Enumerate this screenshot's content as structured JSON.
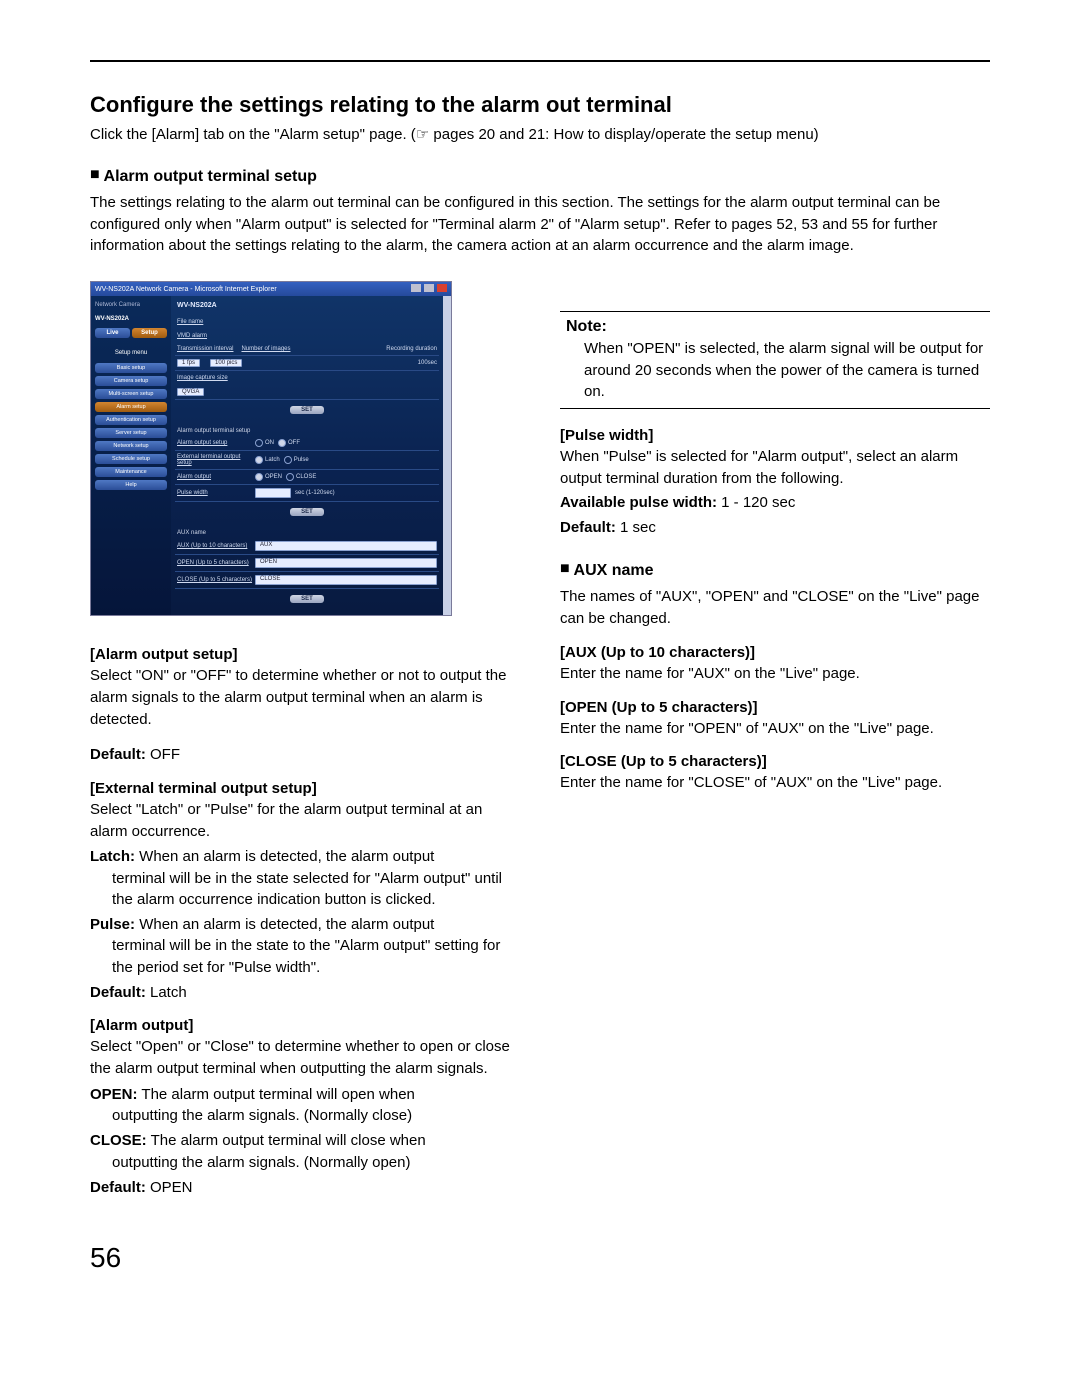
{
  "page": {
    "number": "56"
  },
  "header": {
    "title": "Configure the settings relating to the alarm out terminal",
    "instruction": "Click the [Alarm] tab on the \"Alarm setup\" page. (☞ pages 20 and 21: How to display/operate the setup menu)"
  },
  "section1": {
    "icon": "■",
    "title": "Alarm output terminal setup",
    "body": "The settings relating to the alarm out terminal can be configured in this section. The settings for the alarm output terminal can be configured only when \"Alarm output\" is selected for \"Terminal alarm 2\" of \"Alarm setup\". Refer to pages 52, 53 and 55 for further information about the settings relating to the alarm, the camera action at an alarm occurrence and the alarm image."
  },
  "screenshot": {
    "titlebar": "WV-NS202A Network Camera - Microsoft Internet Explorer",
    "sidebar": {
      "modelLabel": "Network Camera",
      "model": "WV-NS202A",
      "live": "Live",
      "setup": "Setup",
      "menuTitle": "Setup menu",
      "items": [
        "Basic setup",
        "Camera setup",
        "Multi-screen setup",
        "Alarm setup",
        "Authentication setup",
        "Server setup",
        "Network setup",
        "Schedule setup",
        "Maintenance",
        "Help"
      ],
      "activeIndex": 3
    },
    "main": {
      "pageTitle": "WV-NS202A",
      "links": [
        "File name",
        "VMD alarm",
        "Image capture size"
      ],
      "row_interval": {
        "label": "Transmission interval",
        "val": "1 fps"
      },
      "row_numimg": {
        "label": "Number of images",
        "val": "100 pics"
      },
      "row_recdur": {
        "label": "Recording duration",
        "val": "100sec"
      },
      "row_capsize": {
        "label": "",
        "val": "QVGA"
      },
      "set": "SET",
      "group1": "Alarm output terminal setup",
      "rows": {
        "outputSetup": {
          "label": "Alarm output setup",
          "on": "ON",
          "off": "OFF"
        },
        "extSetup": {
          "label": "External terminal output setup",
          "latch": "Latch",
          "pulse": "Pulse"
        },
        "alarmOutput": {
          "label": "Alarm output",
          "open": "OPEN",
          "close": "CLOSE"
        },
        "pulseWidth": {
          "label": "Pulse width",
          "unit": "sec (1-120sec)"
        }
      },
      "group2": "AUX name",
      "rows2": {
        "aux": {
          "label": "AUX (Up to 10 characters)",
          "val": "AUX"
        },
        "open": {
          "label": "OPEN (Up to 5 characters)",
          "val": "OPEN"
        },
        "close": {
          "label": "CLOSE (Up to 5 characters)",
          "val": "CLOSE"
        }
      }
    }
  },
  "left": {
    "h1": "[Alarm output setup]",
    "p1": "Select \"ON\" or \"OFF\" to determine whether or not to output the alarm signals to the alarm output terminal when an alarm is detected.",
    "default1_l": "Default: ",
    "default1_v": "OFF",
    "h2": "[External terminal output setup]",
    "p2": "Select \"Latch\" or \"Pulse\" for the alarm output terminal at an alarm occurrence.",
    "latch_l": "Latch:",
    "latch_v": "When an alarm is detected, the alarm output terminal will be in the state selected for \"Alarm output\" until the alarm occurrence indication button is clicked.",
    "pulse_l": "Pulse:",
    "pulse_v": "When an alarm is detected, the alarm output terminal will be in the state to the \"Alarm output\" setting for the period set for \"Pulse width\".",
    "default2_l": "Default: ",
    "default2_v": "Latch",
    "h3": "[Alarm output]",
    "p3": "Select \"Open\" or \"Close\" to determine whether to open or close the alarm output terminal when outputting the alarm signals.",
    "open_l": "OPEN:",
    "open_v": "The alarm output terminal will open when outputting the alarm signals. (Normally close)",
    "close_l": "CLOSE:",
    "close_v": "The alarm output terminal will close when outputting the alarm signals. (Normally open)",
    "default3_l": "Default: ",
    "default3_v": "OPEN"
  },
  "right": {
    "note_label": "Note:",
    "note_body": "When \"OPEN\" is selected, the alarm signal will be output for around 20 seconds when the power of the camera is turned on.",
    "h1": "[Pulse width]",
    "p1": "When \"Pulse\" is selected for \"Alarm output\", select an alarm output terminal duration from the following.",
    "avail_l": "Available pulse width: ",
    "avail_v": "1 - 120 sec",
    "default1_l": "Default: ",
    "default1_v": "1 sec",
    "section_icon": "■",
    "section_title": "AUX name",
    "p2": "The names of \"AUX\", \"OPEN\" and \"CLOSE\" on the \"Live\" page can be changed.",
    "h2": "[AUX (Up to 10 characters)]",
    "p3": "Enter the name for \"AUX\" on the \"Live\" page.",
    "h3": "[OPEN (Up to 5 characters)]",
    "p4": "Enter the name for \"OPEN\" of \"AUX\" on the \"Live\" page.",
    "h4": "[CLOSE (Up to 5 characters)]",
    "p5": "Enter the name for \"CLOSE\" of \"AUX\" on the \"Live\" page."
  }
}
